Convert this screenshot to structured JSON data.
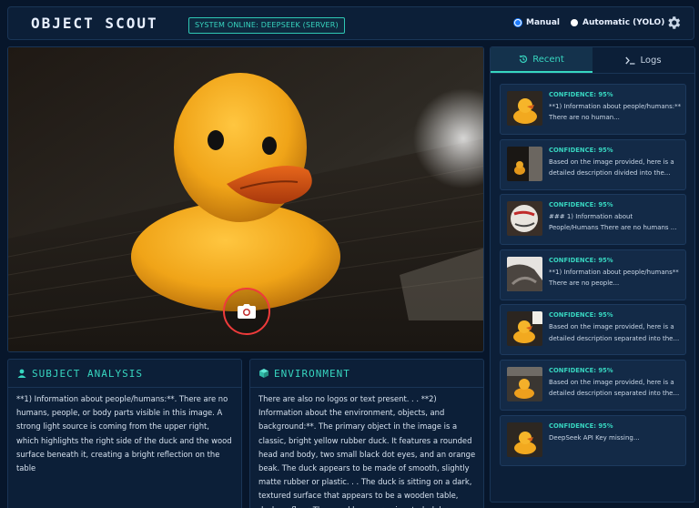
{
  "header": {
    "app_title": "OBJECT SCOUT",
    "status": "SYSTEM ONLINE: DEEPSEEK (SERVER)",
    "modes": [
      {
        "label": "Manual",
        "selected": true
      },
      {
        "label": "Automatic (YOLO)",
        "selected": false
      }
    ]
  },
  "subject": {
    "title": "SUBJECT ANALYSIS",
    "text": "**1) Information about people/humans:**. There are no humans, people, or body parts visible in this image. A strong light source is coming from the upper right, which highlights the right side of the duck and the wood surface beneath it, creating a bright reflection on the table"
  },
  "environment": {
    "title": "ENVIRONMENT",
    "text": "There are also no logos or text present. . . **2) Information about the environment, objects, and background:**. The primary object in the image is a classic, bright yellow rubber duck. It features a rounded head and body, two small black dot eyes, and an orange beak. The duck appears to be made of smooth, slightly matte rubber or plastic. . . The duck is sitting on a dark, textured surface that appears to be a wooden table, desk, or floor. The wood has a prominent, dark brown"
  },
  "side": {
    "tabs": [
      {
        "label": "Recent",
        "active": true,
        "icon": "history-icon"
      },
      {
        "label": "Logs",
        "active": false,
        "icon": "terminal-icon"
      }
    ],
    "cards": [
      {
        "confidence": "CONFIDENCE: 95%",
        "text": "**1) Information about people/humans:** There are no human..."
      },
      {
        "confidence": "CONFIDENCE: 95%",
        "text": "Based on the image provided, here is a detailed description divided into the..."
      },
      {
        "confidence": "CONFIDENCE: 95%",
        "text": "### 1) Information about People/Humans There are no humans ..."
      },
      {
        "confidence": "CONFIDENCE: 95%",
        "text": "**1) Information about people/humans** There are no people..."
      },
      {
        "confidence": "CONFIDENCE: 95%",
        "text": "Based on the image provided, here is a detailed description separated into the..."
      },
      {
        "confidence": "CONFIDENCE: 95%",
        "text": "Based on the image provided, here is a detailed description separated into the..."
      },
      {
        "confidence": "CONFIDENCE: 95%",
        "text": "DeepSeek API Key missing..."
      }
    ]
  },
  "colors": {
    "accent": "#37d6c0",
    "background": "#07162b",
    "panel": "#0c1f38",
    "shutter": "#ef3b3b",
    "selected": "#1c7bff"
  }
}
